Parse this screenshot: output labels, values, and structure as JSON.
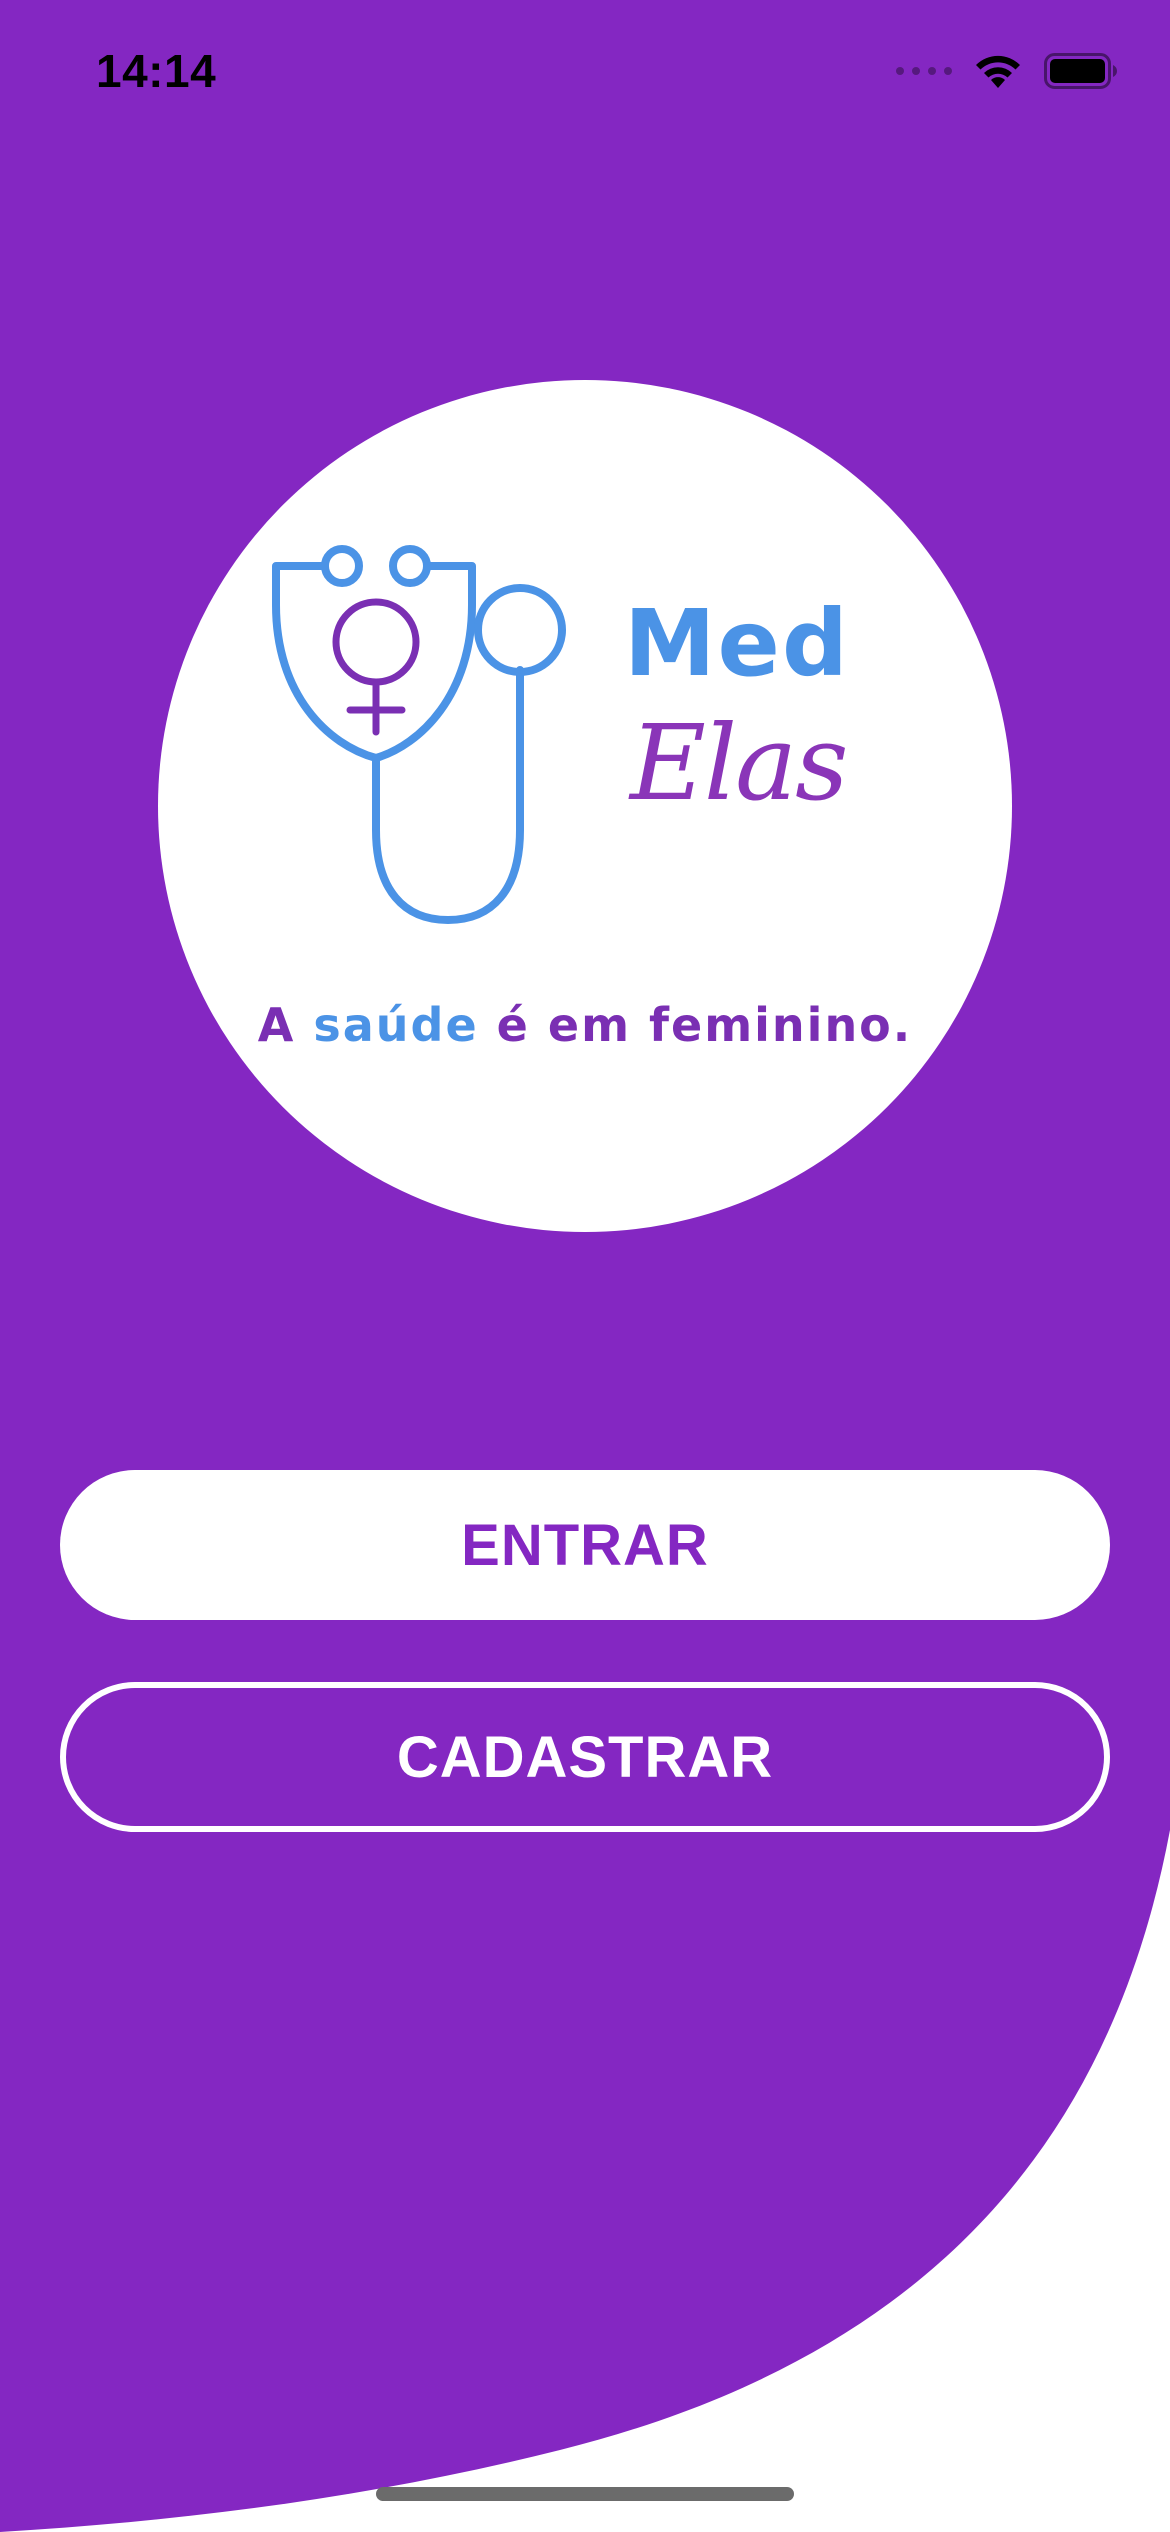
{
  "status_bar": {
    "time": "14:14",
    "icons": [
      "signal-dots-icon",
      "wifi-icon",
      "battery-icon"
    ]
  },
  "logo": {
    "brand_line1": "Med",
    "brand_line2": "Elas",
    "tagline_part1": "A ",
    "tagline_accent": "saúde",
    "tagline_part2": " é em feminino.",
    "icons": [
      "stethoscope-icon",
      "female-symbol-icon"
    ]
  },
  "actions": {
    "entrar_label": "ENTRAR",
    "cadastrar_label": "CADASTRAR"
  },
  "colors": {
    "primary_purple": "#8427c2",
    "logo_blue": "#4b93e6",
    "logo_purple": "#8a35b8",
    "white": "#ffffff"
  }
}
